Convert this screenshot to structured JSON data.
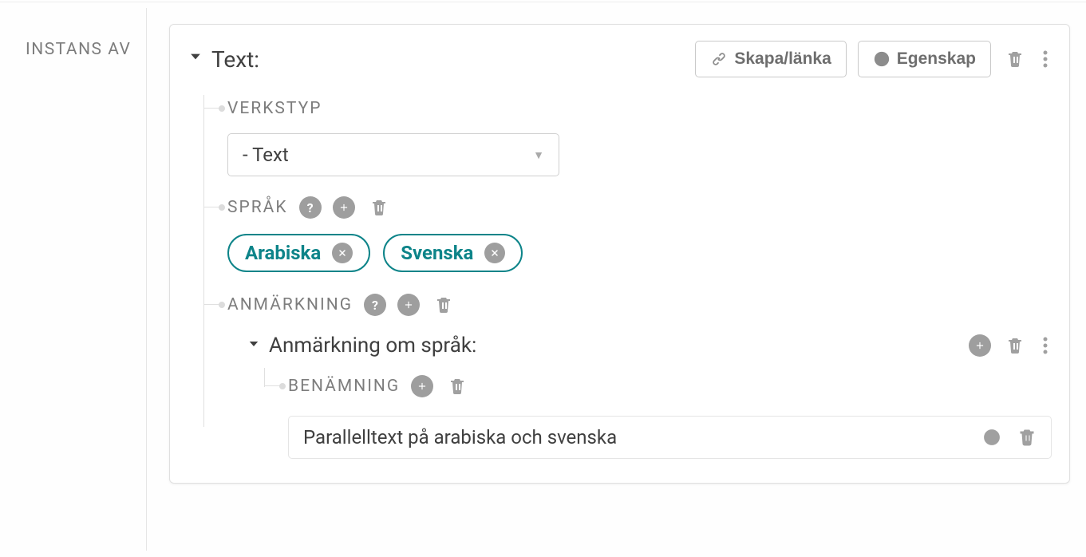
{
  "sidebar": {
    "label": "INSTANS AV"
  },
  "card": {
    "title": "Text:",
    "buttons": {
      "create_link": "Skapa/länka",
      "property": "Egenskap"
    }
  },
  "workstype": {
    "label": "VERKSTYP",
    "selected": "- Text"
  },
  "language": {
    "label": "SPRÅK",
    "pills": [
      {
        "label": "Arabiska"
      },
      {
        "label": "Svenska"
      }
    ]
  },
  "note": {
    "label": "ANMÄRKNING",
    "sub": {
      "title": "Anmärkning om språk:",
      "name_label": "BENÄMNING",
      "value": "Parallelltext på arabiska och svenska"
    }
  }
}
